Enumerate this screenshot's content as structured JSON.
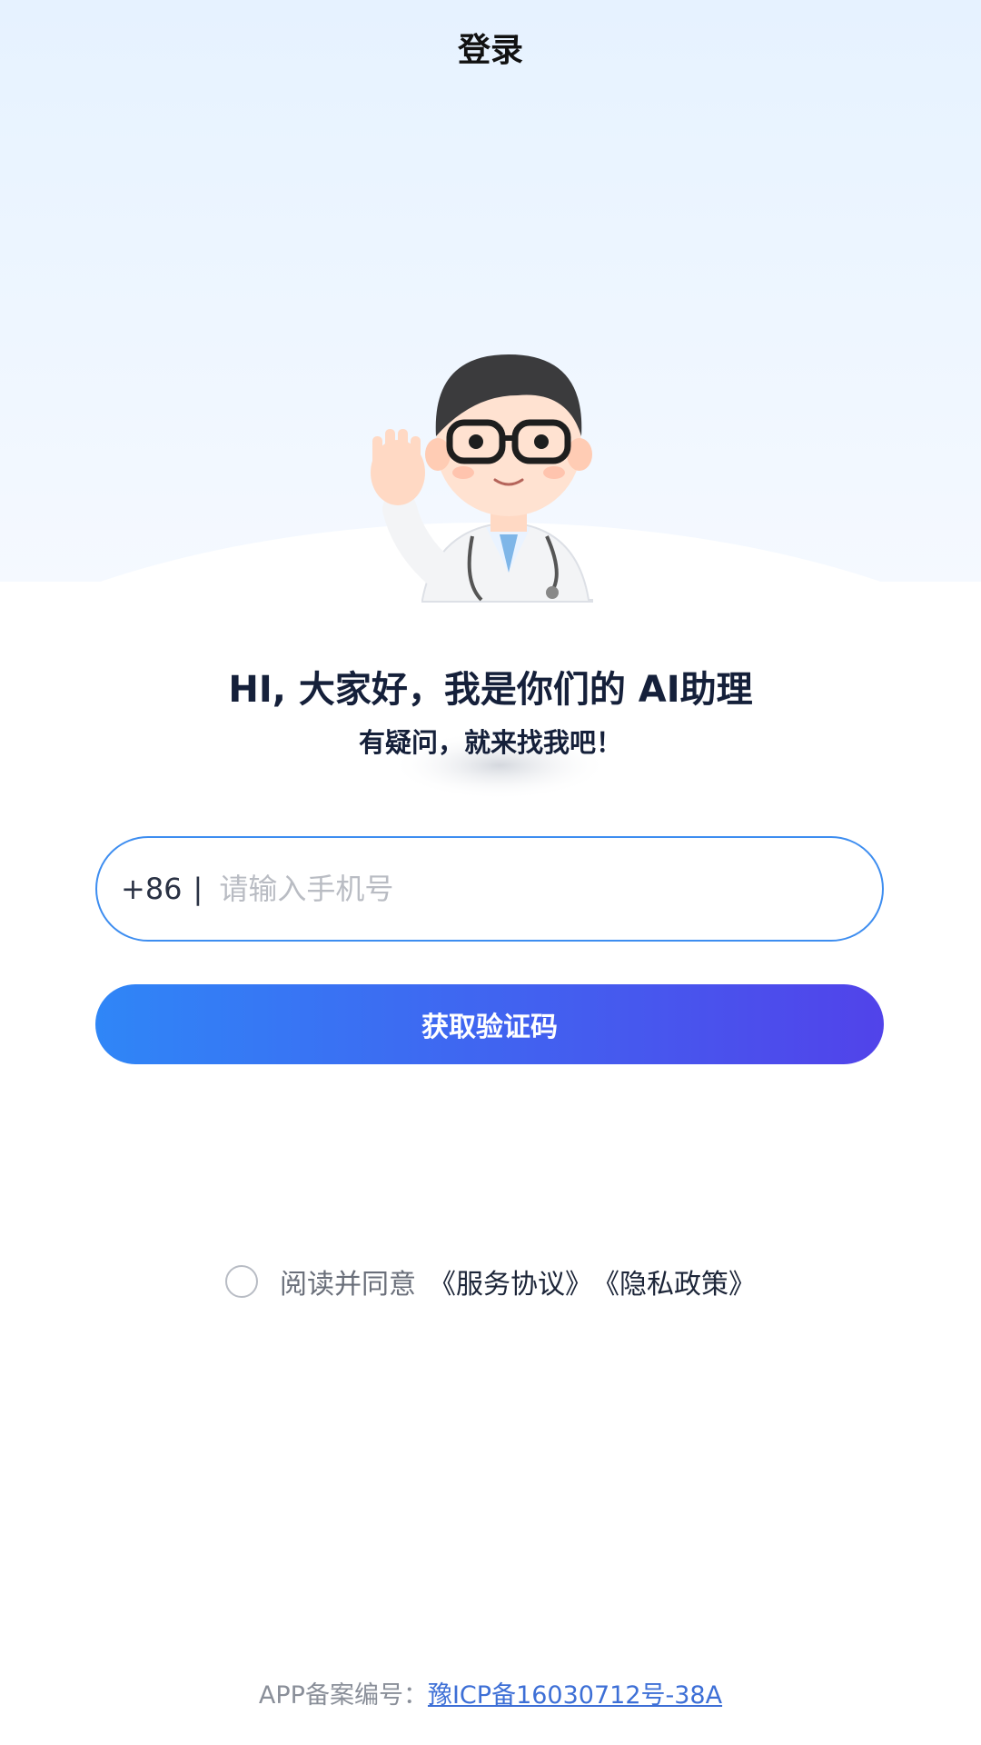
{
  "header": {
    "title": "登录"
  },
  "welcome": {
    "greeting": "HI, 大家好，我是你们的 AI助理",
    "subtitle": "有疑问，就来找我吧！"
  },
  "login_form": {
    "country_code": "+86",
    "divider": "|",
    "phone_placeholder": "请输入手机号",
    "phone_value": "",
    "get_code_label": "获取验证码"
  },
  "agreement": {
    "checked": false,
    "prefix": "阅读并同意",
    "service_link": "《服务协议》",
    "privacy_link": "《隐私政策》"
  },
  "footer": {
    "record_label": "APP备案编号：",
    "record_number": "豫ICP备16030712号-38A"
  },
  "colors": {
    "accent": "#3d8df0",
    "button_gradient_start": "#2f86f7",
    "button_gradient_end": "#5143ea"
  },
  "icons": {
    "mascot": "doctor-mascot-waving"
  }
}
